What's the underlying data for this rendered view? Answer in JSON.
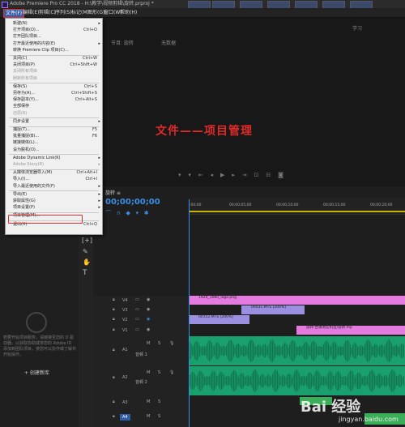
{
  "titlebar": {
    "text": "Adobe Premiere Pro CC 2018 - H:\\教学\\视频剪辑\\旋转.prproj *"
  },
  "menubar": {
    "items": [
      "文件(F)",
      "编辑(E)",
      "剪辑(C)",
      "序列(S)",
      "标记(M)",
      "图形(G)",
      "窗口(W)",
      "帮助(H)"
    ]
  },
  "dropdown": {
    "items": [
      {
        "label": "新建(N)",
        "shortcut": "",
        "arrow": true
      },
      {
        "label": "打开项目(O)...",
        "shortcut": "Ctrl+O"
      },
      {
        "label": "打开团队项目...",
        "shortcut": ""
      },
      {
        "label": "打开最近使用的内容(E)",
        "shortcut": "",
        "arrow": true
      },
      {
        "label": "转换 Premiere Clip 项目(C)...",
        "shortcut": ""
      },
      {
        "label": "关闭(C)",
        "shortcut": "Ctrl+W"
      },
      {
        "label": "关闭项目(P)",
        "shortcut": "Ctrl+Shift+W"
      },
      {
        "label": "关闭所有项目",
        "shortcut": ""
      },
      {
        "label": "刷新所有项目",
        "shortcut": ""
      },
      {
        "label": "保存(S)",
        "shortcut": "Ctrl+S"
      },
      {
        "label": "另存为(A)...",
        "shortcut": "Ctrl+Shift+S"
      },
      {
        "label": "保存副本(Y)...",
        "shortcut": "Ctrl+Alt+S"
      },
      {
        "label": "全部保存",
        "shortcut": ""
      },
      {
        "label": "还原(R)",
        "shortcut": ""
      },
      {
        "label": "同步设置",
        "shortcut": "",
        "arrow": true
      },
      {
        "label": "捕捉(T)...",
        "shortcut": "F5"
      },
      {
        "label": "批量捕捉(B)...",
        "shortcut": "F6"
      },
      {
        "label": "链接媒体(L)...",
        "shortcut": ""
      },
      {
        "label": "设为脱机(O)...",
        "shortcut": ""
      },
      {
        "label": "Adobe Dynamic Link(K)",
        "shortcut": "",
        "arrow": true
      },
      {
        "label": "Adobe Story(R)",
        "shortcut": "",
        "arrow": true
      },
      {
        "label": "从媒体浏览器导入(M)",
        "shortcut": "Ctrl+Alt+I"
      },
      {
        "label": "导入(I)...",
        "shortcut": "Ctrl+I"
      },
      {
        "label": "导入最近使用的文件(F)",
        "shortcut": "",
        "arrow": true
      },
      {
        "label": "导出(E)",
        "shortcut": "",
        "arrow": true
      },
      {
        "label": "获取属性(G)",
        "shortcut": "",
        "arrow": true
      },
      {
        "label": "项目设置(P)",
        "shortcut": "",
        "arrow": true
      },
      {
        "label": "项目管理(M)...",
        "shortcut": ""
      },
      {
        "label": "退出(X)",
        "shortcut": "Ctrl+Q"
      }
    ]
  },
  "monitor": {
    "tabs": [
      "节目: 旋转",
      "无数据"
    ],
    "workspace_label": "学习"
  },
  "overlay_title": "文件——项目管理",
  "timeline": {
    "sequence_tab": "旋转 ≡",
    "timecode": "00;00;00;00",
    "ruler": [
      ":00;00",
      "00;00;05;00",
      "00;00;10;00",
      "00;00;15;00",
      "00;00;20;00"
    ],
    "tracks": [
      {
        "name": "V4"
      },
      {
        "name": "V3"
      },
      {
        "name": "V2"
      },
      {
        "name": "V1"
      },
      {
        "name": "A1",
        "label": "音频 1"
      },
      {
        "name": "A2",
        "label": "音频 2"
      },
      {
        "name": "A3"
      },
      {
        "name": "A4"
      }
    ],
    "clips": {
      "v4": "1920_1080_logo.png",
      "v3": "00031.MTS [200%]",
      "v2": "00152.MTS [200%]",
      "v1": "旋转-古镇港宏机位/旋转.mp"
    }
  },
  "left_panel": {
    "text": "若要开始项目服务，请链接至您的 D 驱动器，以获取协助或将您的 Adobe ID 添加到团队项目，使您可以协作或了解并开始操作。",
    "new_bin": "+ 创建新库"
  },
  "watermark": {
    "text": "Bai 经验",
    "url": "jingyan.baidu.com"
  }
}
